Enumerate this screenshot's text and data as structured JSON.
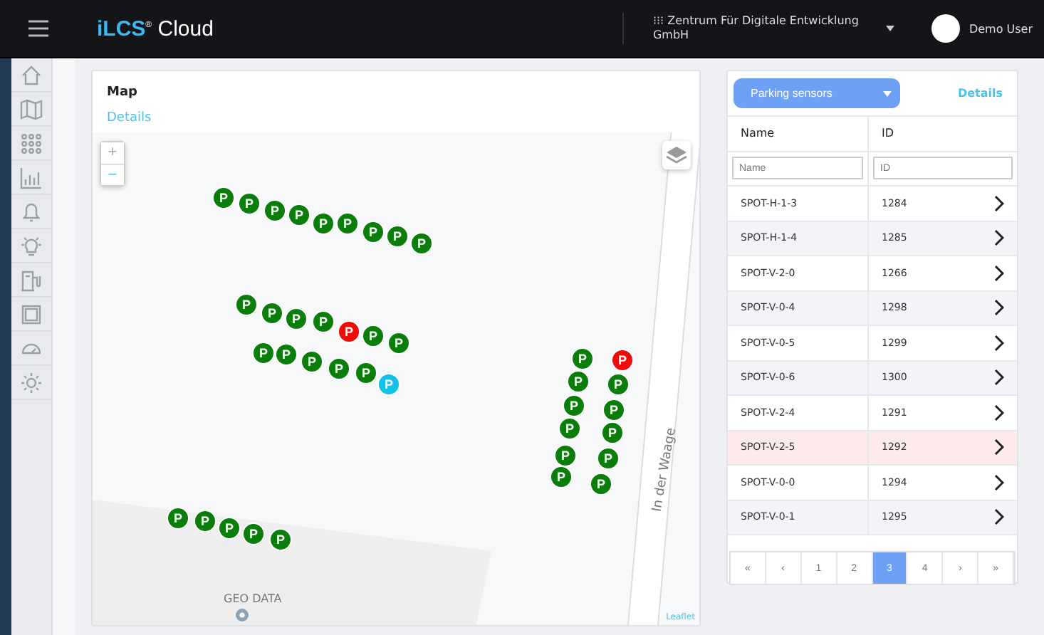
{
  "topbar": {
    "logo_brand": "iLCS",
    "logo_reg": "®",
    "logo_product": "Cloud",
    "org": "Zentrum Für Digitale Entwicklung GmbH",
    "org_icon": "⁝⁝⁝",
    "user": "Demo User"
  },
  "map_card": {
    "title": "Map",
    "link": "Details",
    "zoom_in": "+",
    "zoom_out": "−",
    "street": "In der Waage",
    "place": "GEO DATA",
    "attribution": "Leaflet",
    "markers": [
      {
        "label": "P",
        "color": "#0a7d0a"
      },
      {
        "label": "P",
        "color": "#0a7d0a"
      },
      {
        "label": "P",
        "color": "#0a7d0a"
      },
      {
        "label": "P",
        "color": "#0a7d0a"
      },
      {
        "label": "P",
        "color": "#0a7d0a"
      },
      {
        "label": "P",
        "color": "#0a7d0a"
      },
      {
        "label": "P",
        "color": "#0a7d0a"
      },
      {
        "label": "P",
        "color": "#0a7d0a"
      },
      {
        "label": "P",
        "color": "#0a7d0a"
      },
      {
        "label": "P",
        "color": "#0a7d0a"
      },
      {
        "label": "P",
        "color": "#0a7d0a"
      },
      {
        "label": "P",
        "color": "#0a7d0a"
      },
      {
        "label": "P",
        "color": "#0a7d0a"
      },
      {
        "label": "P",
        "color": "#f00a0a"
      },
      {
        "label": "P",
        "color": "#0a7d0a"
      },
      {
        "label": "P",
        "color": "#0a7d0a"
      },
      {
        "label": "P",
        "color": "#0a7d0a"
      },
      {
        "label": "P",
        "color": "#0a7d0a"
      },
      {
        "label": "P",
        "color": "#0a7d0a"
      },
      {
        "label": "P",
        "color": "#0a7d0a"
      },
      {
        "label": "P",
        "color": "#0a7d0a"
      },
      {
        "label": "P",
        "color": "#12c0e8"
      },
      {
        "label": "P",
        "color": "#0a7d0a"
      },
      {
        "label": "P",
        "color": "#0a7d0a"
      },
      {
        "label": "P",
        "color": "#0a7d0a"
      },
      {
        "label": "P",
        "color": "#0a7d0a"
      },
      {
        "label": "P",
        "color": "#0a7d0a"
      },
      {
        "label": "P",
        "color": "#0a7d0a"
      },
      {
        "label": "P",
        "color": "#f00a0a"
      },
      {
        "label": "P",
        "color": "#0a7d0a"
      },
      {
        "label": "P",
        "color": "#0a7d0a"
      },
      {
        "label": "P",
        "color": "#0a7d0a"
      },
      {
        "label": "P",
        "color": "#0a7d0a"
      },
      {
        "label": "P",
        "color": "#0a7d0a"
      },
      {
        "label": "P",
        "color": "#0a7d0a"
      },
      {
        "label": "P",
        "color": "#0a7d0a"
      },
      {
        "label": "P",
        "color": "#0a7d0a"
      },
      {
        "label": "P",
        "color": "#0a7d0a"
      },
      {
        "label": "P",
        "color": "#0a7d0a"
      }
    ]
  },
  "sensor_card": {
    "dropdown": "Parking sensors",
    "link": "Details",
    "table": {
      "columns": [
        "Name",
        "ID"
      ],
      "filters": [
        {
          "placeholder": "Name"
        },
        {
          "placeholder": "ID"
        }
      ],
      "rows": [
        {
          "name": "SPOT-H-1-3",
          "id": "1284",
          "selected": false
        },
        {
          "name": "SPOT-H-1-4",
          "id": "1285",
          "selected": false
        },
        {
          "name": "SPOT-V-2-0",
          "id": "1266",
          "selected": false
        },
        {
          "name": "SPOT-V-0-4",
          "id": "1298",
          "selected": false
        },
        {
          "name": "SPOT-V-0-5",
          "id": "1299",
          "selected": false
        },
        {
          "name": "SPOT-V-0-6",
          "id": "1300",
          "selected": false
        },
        {
          "name": "SPOT-V-2-4",
          "id": "1291",
          "selected": false
        },
        {
          "name": "SPOT-V-2-5",
          "id": "1292",
          "selected": true
        },
        {
          "name": "SPOT-V-0-0",
          "id": "1294",
          "selected": false
        },
        {
          "name": "SPOT-V-0-1",
          "id": "1295",
          "selected": false
        }
      ]
    },
    "pagination": [
      {
        "label": "«",
        "selected": false
      },
      {
        "label": "‹",
        "selected": false
      },
      {
        "label": "1",
        "selected": false
      },
      {
        "label": "2",
        "selected": false
      },
      {
        "label": "3",
        "selected": true
      },
      {
        "label": "4",
        "selected": false
      },
      {
        "label": "›",
        "selected": false
      },
      {
        "label": "»",
        "selected": false
      }
    ]
  }
}
